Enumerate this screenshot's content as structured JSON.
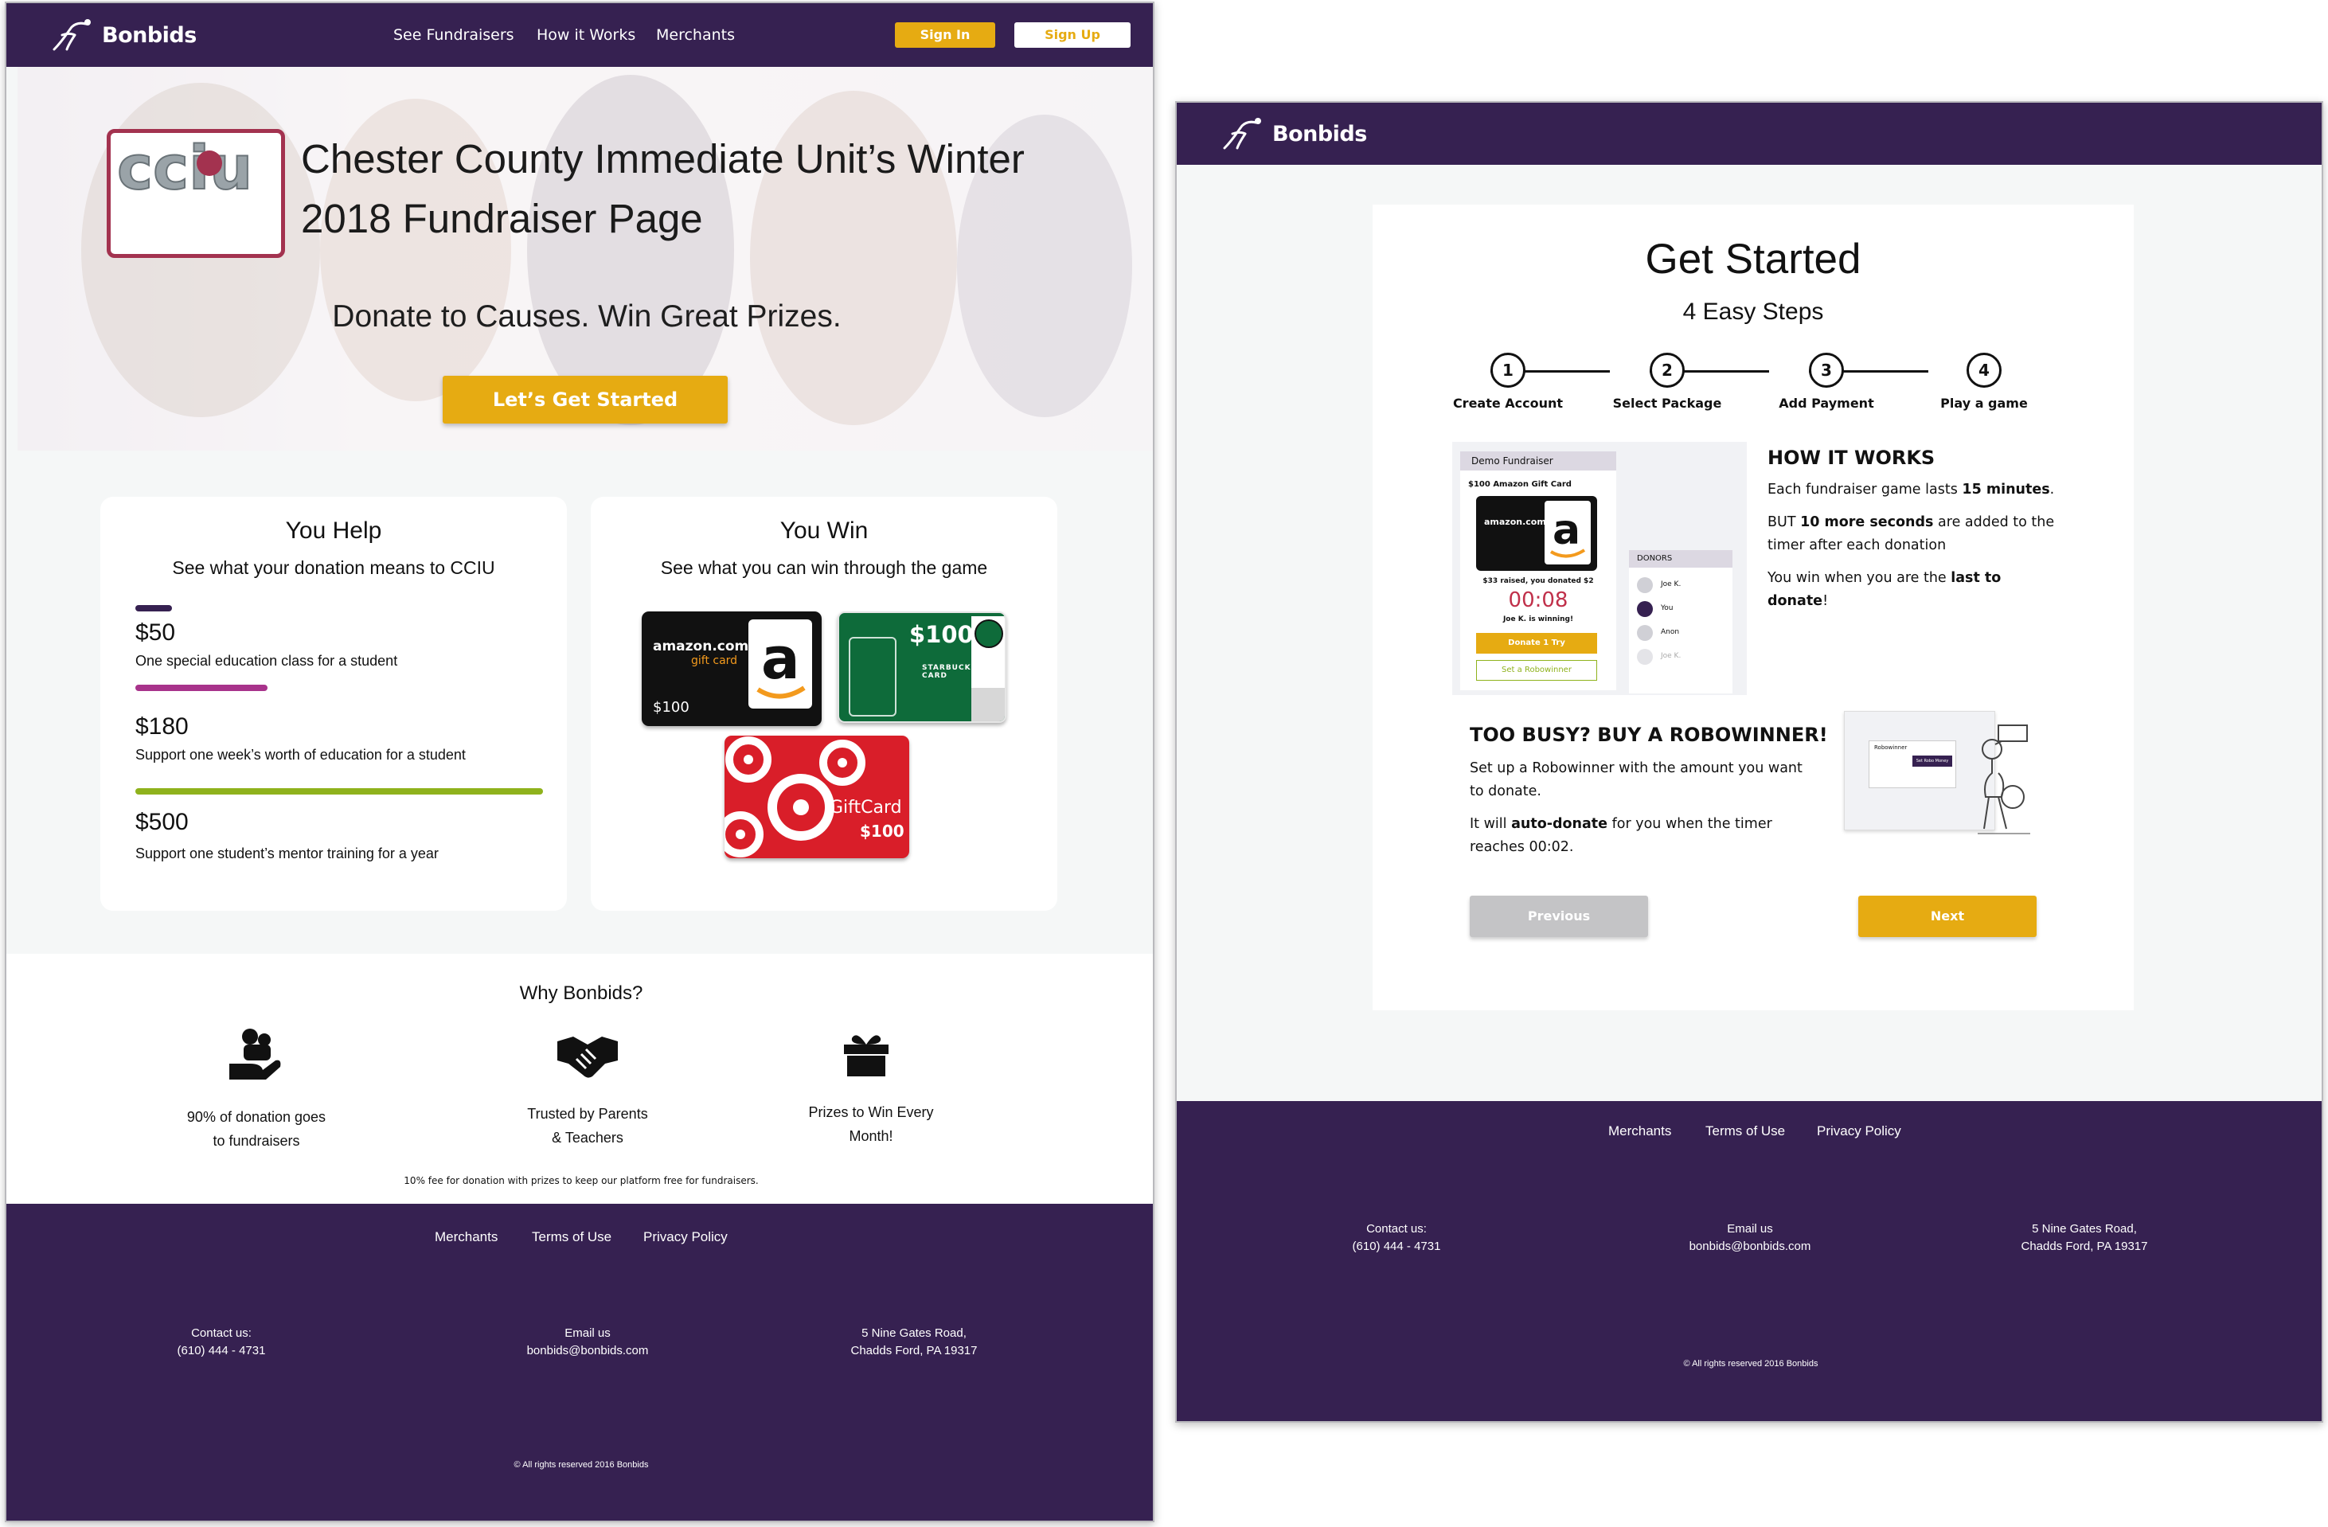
{
  "brand": {
    "name": "Bonbids"
  },
  "nav": {
    "links": [
      "See Fundraisers",
      "How it Works",
      "Merchants"
    ],
    "signin": "Sign In",
    "signup": "Sign Up"
  },
  "hero": {
    "logo_text": "cciu",
    "title_line1": "Chester County Immediate Unit’s Winter",
    "title_line2": "2018 Fundraiser Page",
    "tagline": "Donate to Causes. Win Great Prizes.",
    "cta": "Let’s Get Started"
  },
  "help": {
    "title": "You Help",
    "subtitle": "See what your donation means to CCIU",
    "tiers": [
      {
        "amount": "$50",
        "desc": "One special education class for a student",
        "color": "#362151"
      },
      {
        "amount": "$180",
        "desc": "Support one week’s worth of education for a student",
        "color": "#a8338b"
      },
      {
        "amount": "$500",
        "desc": "Support one student’s mentor training for a year",
        "color": "#8fb21c"
      }
    ]
  },
  "win": {
    "title": "You Win",
    "subtitle": "See what you can win through the game",
    "cards": {
      "amazon": {
        "brand": "amazon.com",
        "kind": "gift card",
        "value": "$100"
      },
      "starbucks": {
        "value": "$100",
        "label": "STARBUCKS CARD"
      },
      "target": {
        "label": "GiftCard",
        "value": "$100"
      }
    }
  },
  "why": {
    "title": "Why Bonbids?",
    "features": [
      {
        "icon": "donation-hand-icon",
        "line1": "90% of donation goes",
        "line2": "to fundraisers"
      },
      {
        "icon": "handshake-icon",
        "line1": "Trusted by Parents",
        "line2": "& Teachers"
      },
      {
        "icon": "gift-icon",
        "line1": "Prizes to Win Every",
        "line2": "Month!"
      }
    ],
    "fee_note": "10% fee for donation with prizes to keep our platform free for fundraisers."
  },
  "footer": {
    "links": [
      "Merchants",
      "Terms of Use",
      "Privacy Policy"
    ],
    "contact_label": "Contact us:",
    "contact_phone": "(610) 444 - 4731",
    "email_label": "Email us",
    "email": "bonbids@bonbids.com",
    "address1": "5 Nine Gates Road,",
    "address2": "Chadds Ford, PA 19317",
    "copyright": "© All rights reserved 2016 Bonbids"
  },
  "get_started": {
    "title": "Get Started",
    "subtitle": "4 Easy Steps",
    "steps": [
      {
        "num": "1",
        "label": "Create Account"
      },
      {
        "num": "2",
        "label": "Select Package"
      },
      {
        "num": "3",
        "label": "Add Payment"
      },
      {
        "num": "4",
        "label": "Play a game"
      }
    ],
    "demo": {
      "header": "Demo Fundraiser",
      "prize": "$100 Amazon Gift Card",
      "raised": "$33 raised, you donated $2",
      "timer": "00:08",
      "winning": "Joe K. is winning!",
      "donate_btn": "Donate 1 Try",
      "robo_btn": "Set a Robowinner",
      "donors_title": "DONORS",
      "donors": [
        "Joe K.",
        "You",
        "Anon",
        "Joe K."
      ]
    },
    "how": {
      "title": "HOW IT WORKS",
      "p1_pre": "Each fundraiser game lasts ",
      "p1_bold": "15 minutes",
      "p1_post": ".",
      "p2_pre": "BUT ",
      "p2_bold": "10 more seconds",
      "p2_post": " are added to the",
      "p2_line2": "timer after each donation",
      "p3_pre": "You win when you are the ",
      "p3_bold": "last to",
      "p3_bold2": "donate",
      "p3_post": "!"
    },
    "robo": {
      "title": "TOO BUSY? BUY A ROBOWINNER!",
      "p1_line1": "Set up a Robowinner with the amount you want",
      "p1_line2": "to donate.",
      "p2_pre": "It will ",
      "p2_bold": "auto-donate",
      "p2_post": " for you when the timer",
      "p2_line2": "reaches 00:02.",
      "mock_title": "Robowinner",
      "mock_btn": "Set Robo Money"
    },
    "prev": "Previous",
    "next": "Next"
  },
  "colors": {
    "purple": "#362151",
    "gold": "#e6ab12"
  }
}
